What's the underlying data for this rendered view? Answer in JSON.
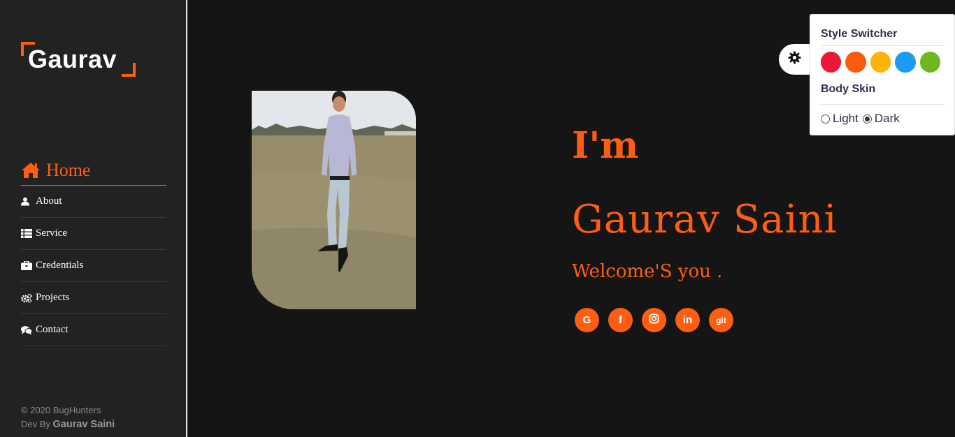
{
  "brand": {
    "logo_text": "Gaurav"
  },
  "sidebar": {
    "items": [
      {
        "label": "Home",
        "icon": "home-icon",
        "active": true
      },
      {
        "label": "About",
        "icon": "user-icon"
      },
      {
        "label": "Service",
        "icon": "list-icon"
      },
      {
        "label": "Credentials",
        "icon": "briefcase-icon"
      },
      {
        "label": "Projects",
        "icon": "cogs-icon"
      },
      {
        "label": "Contact",
        "icon": "comments-icon"
      }
    ],
    "footer": {
      "copyright": "© 2020 BugHunters",
      "dev_prefix": "Dev By",
      "dev_name": "Gaurav Saini"
    }
  },
  "hero": {
    "intro": "I'm",
    "name": "Gaurav Saini",
    "tagline": "Welcome'S you .",
    "socials": [
      {
        "label": "G",
        "icon": "google-icon"
      },
      {
        "label": "f",
        "icon": "facebook-icon"
      },
      {
        "label": "",
        "icon": "instagram-icon"
      },
      {
        "label": "in",
        "icon": "linkedin-icon"
      },
      {
        "label": "git",
        "icon": "git-icon"
      }
    ]
  },
  "switcher": {
    "title": "Style Switcher",
    "colors": [
      "#ec1839",
      "#fa5b0f",
      "#ffb400",
      "#1d9bf0",
      "#6eb81d"
    ],
    "skin_title": "Body Skin",
    "skin_options": [
      {
        "label": "Light",
        "checked": false
      },
      {
        "label": "Dark",
        "checked": true
      }
    ]
  },
  "theme": {
    "accent": "#fe5e12",
    "background": "#151515",
    "sidebar_bg": "#222222"
  }
}
